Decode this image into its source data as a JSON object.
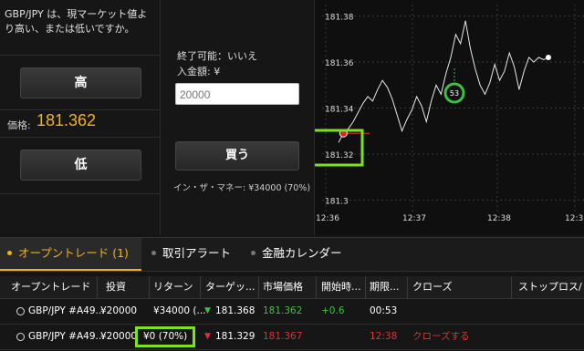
{
  "question": "GBP/JPY は、現マーケット値より高い、または低いですか。",
  "high_label": "高",
  "low_label": "低",
  "price_label": "価格:",
  "price_value": "181.362",
  "closable_label": "終了可能：いいえ",
  "deposit_label": "入金額: ¥",
  "amount_value": "20000",
  "buy_label": "買う",
  "in_the_money": "イン・ザ・マネー: ¥34000 (70%)",
  "chart": {
    "y_ticks": [
      "181.38",
      "181.36",
      "181.34",
      "181.32",
      "181.3"
    ],
    "x_ticks": [
      "12:36",
      "12:37",
      "12:38",
      "12:3"
    ],
    "countdown": "53"
  },
  "chart_data": {
    "type": "line",
    "title": "",
    "ylim": [
      181.3,
      181.39
    ],
    "x_ticks": [
      "12:36",
      "12:37",
      "12:38",
      "12:3"
    ],
    "y_ticks": [
      181.38,
      181.36,
      181.34,
      181.32,
      181.3
    ],
    "series": [
      {
        "values": [
          181.325,
          181.329,
          181.331,
          181.334,
          181.338,
          181.342,
          181.345,
          181.343,
          181.348,
          181.352,
          181.349,
          181.344,
          181.337,
          181.33,
          181.335,
          181.339,
          181.345,
          181.341,
          181.334,
          181.343,
          181.35,
          181.346,
          181.355,
          181.362,
          181.372,
          181.368,
          181.378,
          181.366,
          181.357,
          181.35,
          181.346,
          181.351,
          181.359,
          181.352,
          181.356,
          181.364,
          181.358,
          181.348,
          181.356,
          181.362,
          181.36,
          181.362,
          181.361,
          181.362
        ]
      }
    ],
    "entry_point": 181.329,
    "grid": true
  },
  "tabs": [
    {
      "label": "オープントレード (1)",
      "dot": "#f2b315"
    },
    {
      "label": "取引アラート",
      "dot": "#777777"
    },
    {
      "label": "金融カレンダー",
      "dot": "#777777"
    }
  ],
  "columns": [
    "オープントレード",
    "投資",
    "リターン",
    "ターゲッ...",
    "市場価格",
    "開始時...",
    "期限...",
    "クローズ",
    "ストップロス/"
  ],
  "rows": [
    {
      "asset": "GBP/JPY #A49...",
      "invest": "¥20000",
      "return": "¥34000 (...",
      "target": "181.368",
      "market": "181.362",
      "change": "+0.6",
      "expiry": "00:53",
      "close": ""
    },
    {
      "asset": "GBP/JPY #A49...",
      "invest": "¥20000",
      "return": "¥0 (70%)",
      "target": "181.329",
      "market": "181.367",
      "change": "",
      "expiry": "12:38",
      "close": "クローズする"
    }
  ],
  "colors": {
    "accent": "#f2b315",
    "up": "#3fbf3f",
    "down": "#e03030",
    "highlight": "#7fe01b"
  }
}
